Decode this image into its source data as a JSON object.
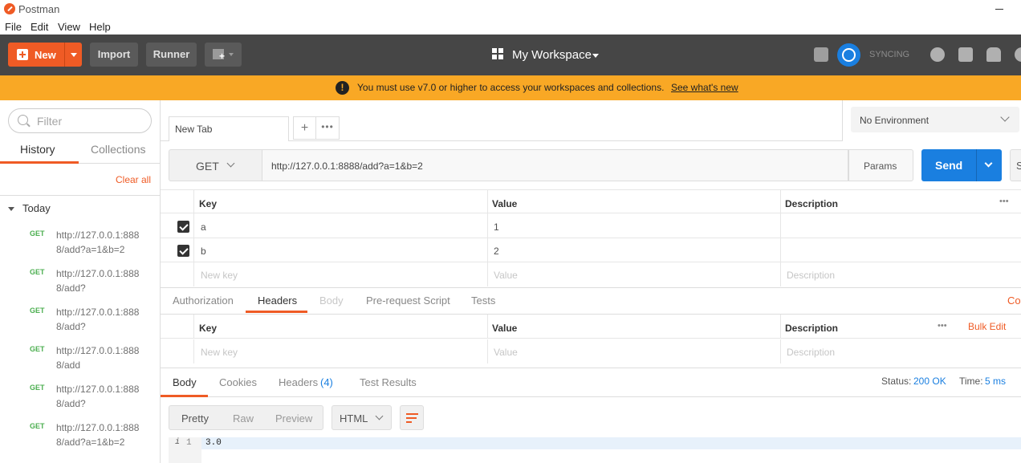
{
  "app": {
    "title": "Postman"
  },
  "menu": [
    "File",
    "Edit",
    "View",
    "Help"
  ],
  "toolbar": {
    "new_label": "New",
    "import_label": "Import",
    "runner_label": "Runner",
    "workspace_label": "My Workspace",
    "sync_label": "SYNCING"
  },
  "banner": {
    "message": "You must use v7.0 or higher to access your workspaces and collections.",
    "link": "See what's new"
  },
  "sidebar": {
    "filter_placeholder": "Filter",
    "tabs": [
      "History",
      "Collections"
    ],
    "active_tab": "History",
    "clear_all": "Clear all",
    "group": "Today",
    "history": [
      {
        "method": "GET",
        "url": "http://127.0.0.1:8888/add?a=1&b=2"
      },
      {
        "method": "GET",
        "url": "http://127.0.0.1:8888/add?"
      },
      {
        "method": "GET",
        "url": "http://127.0.0.1:8888/add?"
      },
      {
        "method": "GET",
        "url": "http://127.0.0.1:8888/add"
      },
      {
        "method": "GET",
        "url": "http://127.0.0.1:8888/add?"
      },
      {
        "method": "GET",
        "url": "http://127.0.0.1:8888/add?a=1&b=2"
      }
    ]
  },
  "tabs": {
    "active": "New Tab",
    "add": "+",
    "more": "•••"
  },
  "environment": {
    "selected": "No Environment"
  },
  "request": {
    "method": "GET",
    "url": "http://127.0.0.1:8888/add?a=1&b=2",
    "params_label": "Params",
    "send_label": "Send",
    "save_label": "S"
  },
  "params_table": {
    "headers": [
      "Key",
      "Value",
      "Description"
    ],
    "more": "•••",
    "rows": [
      {
        "checked": true,
        "key": "a",
        "value": "1",
        "description": ""
      },
      {
        "checked": true,
        "key": "b",
        "value": "2",
        "description": ""
      }
    ],
    "placeholder": {
      "key": "New key",
      "value": "Value",
      "description": "Description"
    }
  },
  "request_tabs": {
    "items": [
      "Authorization",
      "Headers",
      "Body",
      "Pre-request Script",
      "Tests"
    ],
    "active": "Headers",
    "disabled": [
      "Body"
    ],
    "right": "Coo"
  },
  "headers_table": {
    "headers": [
      "Key",
      "Value",
      "Description"
    ],
    "more": "•••",
    "bulk_edit": "Bulk Edit",
    "placeholder": {
      "key": "New key",
      "value": "Value",
      "description": "Description"
    }
  },
  "response": {
    "tabs": [
      {
        "label": "Body"
      },
      {
        "label": "Cookies"
      },
      {
        "label": "Headers",
        "count": "(4)"
      },
      {
        "label": "Test Results"
      }
    ],
    "active": "Body",
    "status_label": "Status:",
    "status_value": "200 OK",
    "time_label": "Time:",
    "time_value": "5 ms",
    "view_modes": [
      "Pretty",
      "Raw",
      "Preview"
    ],
    "active_view": "Pretty",
    "format": "HTML",
    "lines": [
      {
        "number": "1",
        "marker": "i",
        "text": "3.0"
      }
    ]
  },
  "colors": {
    "brand": "#ef5b25",
    "accent_blue": "#1a7fe0",
    "banner": "#f9a825",
    "toolbar": "#464646",
    "method_get": "#4caf50"
  }
}
